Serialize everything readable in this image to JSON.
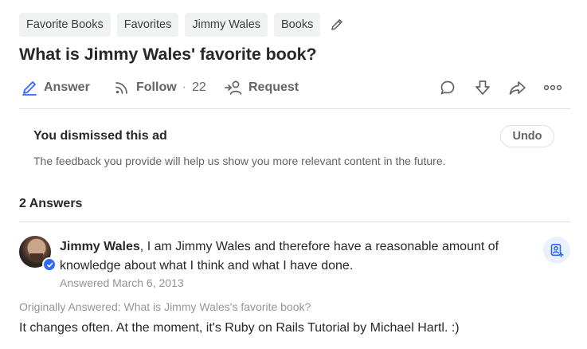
{
  "topics": [
    "Favorite Books",
    "Favorites",
    "Jimmy Wales",
    "Books"
  ],
  "question": {
    "title": "What is Jimmy Wales' favorite book?"
  },
  "actions": {
    "answer_label": "Answer",
    "follow_label": "Follow",
    "follow_separator": "·",
    "follow_count": "22",
    "request_label": "Request"
  },
  "ad": {
    "dismissed_title": "You dismissed this ad",
    "feedback_text": "The feedback you provide will help us show you more relevant content in the future.",
    "undo_label": "Undo"
  },
  "answers": {
    "count_label": "2 Answers",
    "items": [
      {
        "author": "Jimmy Wales",
        "credential": ", I am Jimmy Wales and therefore have a reasonable amount of knowledge about what I think and what I have done.",
        "answered_date": "Answered March 6, 2013",
        "originally_answered": "Originally Answered: What is Jimmy Wales's favorite book?",
        "body": "It changes often. At the moment, it's Ruby on Rails Tutorial by Michael Hartl. :)"
      }
    ]
  },
  "icons": {
    "edit": "pencil-icon",
    "answer": "answer-pencil-icon",
    "follow": "rss-follow-icon",
    "request": "request-person-icon",
    "comment": "comment-icon",
    "downvote": "downvote-arrow-icon",
    "share": "share-arrow-icon",
    "more": "more-dots-icon",
    "verified": "verified-check-icon",
    "follow_person": "follow-person-icon"
  },
  "colors": {
    "accent_blue": "#2e69ff",
    "text_primary": "#282829",
    "text_secondary": "#636466",
    "text_muted": "#939598",
    "chip_bg": "#f1f2f2",
    "divider": "#dee0e1"
  }
}
